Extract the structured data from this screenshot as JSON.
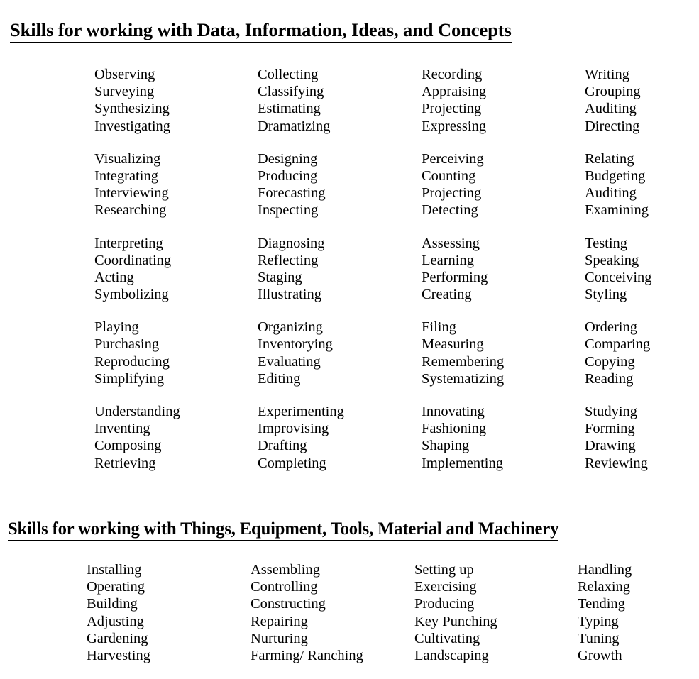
{
  "document": {
    "sections": [
      {
        "heading": "Skills for working with Data, Information, Ideas, and Concepts",
        "groups": [
          {
            "columns": [
              [
                "Observing",
                "Surveying",
                "Synthesizing",
                "Investigating"
              ],
              [
                "Collecting",
                "Classifying",
                "Estimating",
                "Dramatizing"
              ],
              [
                "Recording",
                "Appraising",
                "Projecting",
                "Expressing"
              ],
              [
                "Writing",
                "Grouping",
                "Auditing",
                "Directing"
              ]
            ]
          },
          {
            "columns": [
              [
                "Visualizing",
                "Integrating",
                "Interviewing",
                "Researching"
              ],
              [
                "Designing",
                "Producing",
                "Forecasting",
                "Inspecting"
              ],
              [
                "Perceiving",
                "Counting",
                "Projecting",
                "Detecting"
              ],
              [
                "Relating",
                "Budgeting",
                "Auditing",
                "Examining"
              ]
            ]
          },
          {
            "columns": [
              [
                "Interpreting",
                "Coordinating",
                "Acting",
                "Symbolizing"
              ],
              [
                "Diagnosing",
                "Reflecting",
                "Staging",
                "Illustrating"
              ],
              [
                "Assessing",
                "Learning",
                "Performing",
                "Creating"
              ],
              [
                "Testing",
                "Speaking",
                "Conceiving",
                "Styling"
              ]
            ]
          },
          {
            "columns": [
              [
                "Playing",
                "Purchasing",
                "Reproducing",
                "Simplifying"
              ],
              [
                "Organizing",
                "Inventorying",
                "Evaluating",
                "Editing"
              ],
              [
                "Filing",
                "Measuring",
                "Remembering",
                "Systematizing"
              ],
              [
                "Ordering",
                "Comparing",
                "Copying",
                "Reading"
              ]
            ]
          },
          {
            "columns": [
              [
                "Understanding",
                "Inventing",
                "Composing",
                "Retrieving"
              ],
              [
                "Experimenting",
                "Improvising",
                "Drafting",
                "Completing"
              ],
              [
                "Innovating",
                "Fashioning",
                "Shaping",
                "Implementing"
              ],
              [
                "Studying",
                "Forming",
                "Drawing",
                "Reviewing"
              ]
            ]
          }
        ]
      },
      {
        "heading": "Skills for working with Things, Equipment, Tools, Material and Machinery",
        "groups": [
          {
            "columns": [
              [
                "Installing",
                "Operating",
                "Building",
                "Adjusting",
                "Gardening",
                "Harvesting"
              ],
              [
                "Assembling",
                "Controlling",
                "Constructing",
                "Repairing",
                "Nurturing",
                "Farming/ Ranching"
              ],
              [
                "Setting up",
                "Exercising",
                "Producing",
                "Key Punching",
                "Cultivating",
                "Landscaping"
              ],
              [
                "Handling",
                "Relaxing",
                "Tending",
                "Typing",
                "Tuning",
                "Growth"
              ]
            ]
          }
        ]
      }
    ]
  }
}
